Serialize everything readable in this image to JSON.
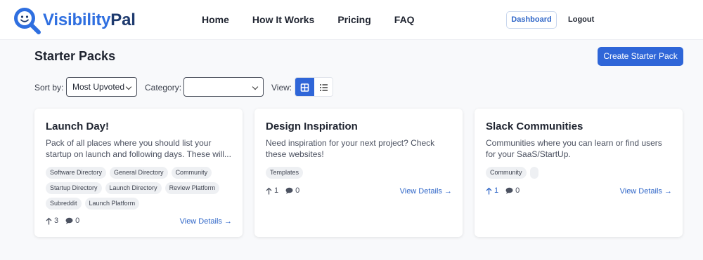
{
  "app": {
    "logo_part1": "Visibility",
    "logo_part2": "Pal"
  },
  "nav": {
    "items": [
      {
        "label": "Home"
      },
      {
        "label": "How It Works"
      },
      {
        "label": "Pricing"
      },
      {
        "label": "FAQ"
      }
    ],
    "dashboard_label": "Dashboard",
    "logout_label": "Logout"
  },
  "page": {
    "title": "Starter Packs",
    "create_label": "Create Starter Pack"
  },
  "filters": {
    "sort_label": "Sort by:",
    "sort_value": "Most Upvoted",
    "category_label": "Category:",
    "category_value": "",
    "view_label": "View:"
  },
  "colors": {
    "accent": "#2f66d8",
    "brand_dark": "#1e3a6e",
    "brand_light": "#2f6fe0"
  },
  "cards": [
    {
      "title": "Launch Day!",
      "description": "Pack of all places where you should list your startup on launch and following days. These will...",
      "tags": [
        "Software Directory",
        "General Directory",
        "Community",
        "Startup Directory",
        "Launch Directory",
        "Review Platform",
        "Subreddit",
        "Launch Platform"
      ],
      "upvotes": "3",
      "comments": "0",
      "upvoted": false,
      "link_label": "View Details →"
    },
    {
      "title": "Design Inspiration",
      "description": "Need inspiration for your next project? Check these websites!",
      "tags": [
        "Templates"
      ],
      "upvotes": "1",
      "comments": "0",
      "upvoted": false,
      "link_label": "View Details →"
    },
    {
      "title": "Slack Communities",
      "description": "Communities where you can learn or find users for your SaaS/StartUp.",
      "tags": [
        "Community",
        ""
      ],
      "upvotes": "1",
      "comments": "0",
      "upvoted": true,
      "link_label": "View Details →"
    }
  ]
}
